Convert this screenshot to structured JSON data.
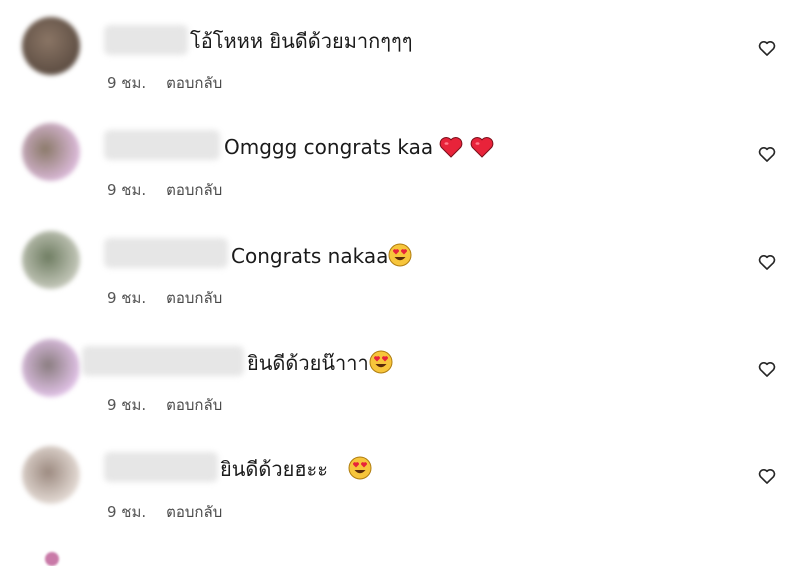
{
  "comments": [
    {
      "text": "โอ้โหหห ยินดีด้วยมากๆๆๆ",
      "time": "9 ชม.",
      "reply": "ตอบกลับ",
      "avatar_color": "#6b5a4e",
      "emoji": []
    },
    {
      "text": "Omggg congrats kaa",
      "time": "9 ชม.",
      "reply": "ตอบกลับ",
      "avatar_color": "#b59a8c",
      "emoji": [
        "red-heart",
        "red-heart"
      ]
    },
    {
      "text": "Congrats nakaa",
      "time": "9 ชม.",
      "reply": "ตอบกลับ",
      "avatar_color": "#7e8a70",
      "emoji": [
        "heart-eyes"
      ]
    },
    {
      "text": "ยินดีด้วยน๊าาา",
      "time": "9 ชม.",
      "reply": "ตอบกลับ",
      "avatar_color": "#b8a0b8",
      "emoji": [
        "heart-eyes"
      ]
    },
    {
      "text": "ยินดีด้วยฮะะ ",
      "time": "9 ชม.",
      "reply": "ตอบกลับ",
      "avatar_color": "#a08a80",
      "emoji": [
        "heart-eyes"
      ]
    }
  ],
  "like_icon": "heart-outline-icon",
  "colors": {
    "heart": "#e8233a",
    "emoji_face": "#f7c53b",
    "text": "#1a1a1a",
    "meta": "#555555"
  }
}
